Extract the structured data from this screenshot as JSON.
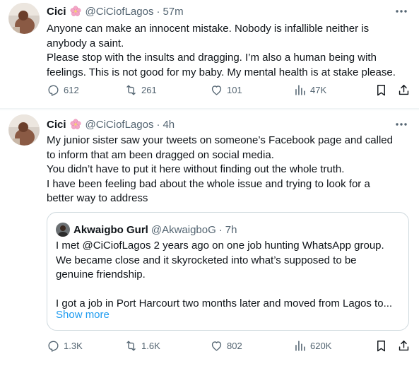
{
  "tweets": [
    {
      "name": "Cici",
      "handle": "@CiCiofLagos",
      "time": "57m",
      "body": [
        "Anyone can make an innocent mistake. Nobody is infallible neither is",
        "anybody a saint.",
        "Please stop with the insults and dragging. I’m also a human being with",
        "feelings. This is not good for my baby. My mental health is at stake please."
      ],
      "actions": {
        "replies": "612",
        "reposts": "261",
        "likes": "101",
        "views": "47K"
      }
    },
    {
      "name": "Cici",
      "handle": "@CiCiofLagos",
      "time": "4h",
      "body": [
        "My junior sister saw your tweets on someone’s Facebook page and called",
        "to inform that am been dragged on social media.",
        "You didn’t have to put it here without finding out the whole truth.",
        "I have been feeling bad about the whole issue and trying to look for a",
        "better way to address"
      ],
      "quote": {
        "name": "Akwaigbo Gurl",
        "handle": "@AkwaigboG",
        "time": "7h",
        "body": [
          "I met @CiCiofLagos 2 years ago on one job hunting WhatsApp group.",
          "We became close and it skyrocketed into what’s supposed to be",
          "genuine friendship.",
          "",
          "I got a job in Port Harcourt two months later and moved from Lagos to..."
        ],
        "show_more": "Show more"
      },
      "actions": {
        "replies": "1.3K",
        "reposts": "1.6K",
        "likes": "802",
        "views": "620K"
      }
    }
  ],
  "icons": {
    "reply": "reply-icon",
    "repost": "repost-icon",
    "like": "heart-icon",
    "views": "views-icon",
    "bookmark": "bookmark-icon",
    "share": "share-icon",
    "more": "more-icon",
    "flower": "cherry-blossom-emoji"
  },
  "colors": {
    "text": "#0f1419",
    "muted": "#536471",
    "link": "#1d9bf0",
    "border": "#cfd9de",
    "flower": "#f4a6c6"
  }
}
